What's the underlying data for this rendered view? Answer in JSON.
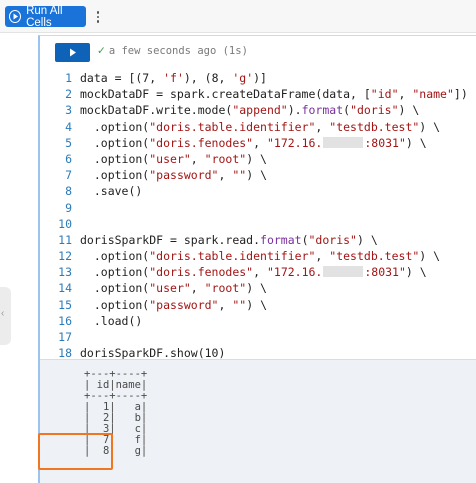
{
  "toolbar": {
    "run_all_label": "Run All Cells",
    "run_all_icon": "play-circle-icon",
    "more_icon": "more-vertical-icon"
  },
  "cell": {
    "run_icon": "play-icon",
    "status_icon": "check-icon",
    "status_text": "a few seconds ago (1s)",
    "code_lines": [
      {
        "num": "1",
        "tokens": [
          {
            "t": "data = [(7, "
          },
          {
            "t": "'f'",
            "c": "str"
          },
          {
            "t": "), (8, "
          },
          {
            "t": "'g'",
            "c": "str"
          },
          {
            "t": ")]"
          }
        ]
      },
      {
        "num": "2",
        "tokens": [
          {
            "t": "mockDataDF = spark.createDataFrame(data, ["
          },
          {
            "t": "\"id\"",
            "c": "str"
          },
          {
            "t": ", "
          },
          {
            "t": "\"name\"",
            "c": "str"
          },
          {
            "t": "])"
          }
        ]
      },
      {
        "num": "3",
        "tokens": [
          {
            "t": "mockDataDF.write.mode("
          },
          {
            "t": "\"append\"",
            "c": "str"
          },
          {
            "t": ")."
          },
          {
            "t": "format",
            "c": "fn"
          },
          {
            "t": "("
          },
          {
            "t": "\"doris\"",
            "c": "str"
          },
          {
            "t": ") \\"
          }
        ]
      },
      {
        "num": "4",
        "tokens": [
          {
            "t": "  .option("
          },
          {
            "t": "\"doris.table.identifier\"",
            "c": "str"
          },
          {
            "t": ", "
          },
          {
            "t": "\"testdb.test\"",
            "c": "str"
          },
          {
            "t": ") \\"
          }
        ]
      },
      {
        "num": "5",
        "tokens": [
          {
            "t": "  .option("
          },
          {
            "t": "\"doris.fenodes\"",
            "c": "str"
          },
          {
            "t": ", "
          },
          {
            "t": "\"172.16.",
            "c": "str"
          },
          {
            "mask": true
          },
          {
            "t": ":8031\"",
            "c": "str"
          },
          {
            "t": ") \\"
          }
        ]
      },
      {
        "num": "6",
        "tokens": [
          {
            "t": "  .option("
          },
          {
            "t": "\"user\"",
            "c": "str"
          },
          {
            "t": ", "
          },
          {
            "t": "\"root\"",
            "c": "str"
          },
          {
            "t": ") \\"
          }
        ]
      },
      {
        "num": "7",
        "tokens": [
          {
            "t": "  .option("
          },
          {
            "t": "\"password\"",
            "c": "str"
          },
          {
            "t": ", "
          },
          {
            "t": "\"\"",
            "c": "str"
          },
          {
            "t": ") \\"
          }
        ]
      },
      {
        "num": "8",
        "tokens": [
          {
            "t": "  .save()"
          }
        ]
      },
      {
        "num": "9",
        "tokens": []
      },
      {
        "num": "10",
        "tokens": []
      },
      {
        "num": "11",
        "tokens": [
          {
            "t": "dorisSparkDF = spark.read."
          },
          {
            "t": "format",
            "c": "fn"
          },
          {
            "t": "("
          },
          {
            "t": "\"doris\"",
            "c": "str"
          },
          {
            "t": ") \\"
          }
        ]
      },
      {
        "num": "12",
        "tokens": [
          {
            "t": "  .option("
          },
          {
            "t": "\"doris.table.identifier\"",
            "c": "str"
          },
          {
            "t": ", "
          },
          {
            "t": "\"testdb.test\"",
            "c": "str"
          },
          {
            "t": ") \\"
          }
        ]
      },
      {
        "num": "13",
        "tokens": [
          {
            "t": "  .option("
          },
          {
            "t": "\"doris.fenodes\"",
            "c": "str"
          },
          {
            "t": ", "
          },
          {
            "t": "\"172.16.",
            "c": "str"
          },
          {
            "mask": true
          },
          {
            "t": ":8031\"",
            "c": "str"
          },
          {
            "t": ") \\"
          }
        ]
      },
      {
        "num": "14",
        "tokens": [
          {
            "t": "  .option("
          },
          {
            "t": "\"user\"",
            "c": "str"
          },
          {
            "t": ", "
          },
          {
            "t": "\"root\"",
            "c": "str"
          },
          {
            "t": ") \\"
          }
        ]
      },
      {
        "num": "15",
        "tokens": [
          {
            "t": "  .option("
          },
          {
            "t": "\"password\"",
            "c": "str"
          },
          {
            "t": ", "
          },
          {
            "t": "\"\"",
            "c": "str"
          },
          {
            "t": ") \\"
          }
        ]
      },
      {
        "num": "16",
        "tokens": [
          {
            "t": "  .load()"
          }
        ]
      },
      {
        "num": "17",
        "tokens": []
      },
      {
        "num": "18",
        "tokens": [
          {
            "t": "dorisSparkDF.show(10)"
          }
        ]
      }
    ],
    "output_lines": [
      "+---+----+",
      "| id|name|",
      "+---+----+",
      "|  1|   a|",
      "|  2|   b|",
      "|  3|   c|",
      "|  7|   f|",
      "|  8|   g|"
    ]
  },
  "colors": {
    "accent": "#1a73d9",
    "run_button": "#0e63b8",
    "highlight": "#f07622",
    "string": "#a31515",
    "line_number": "#2b7bb9"
  }
}
